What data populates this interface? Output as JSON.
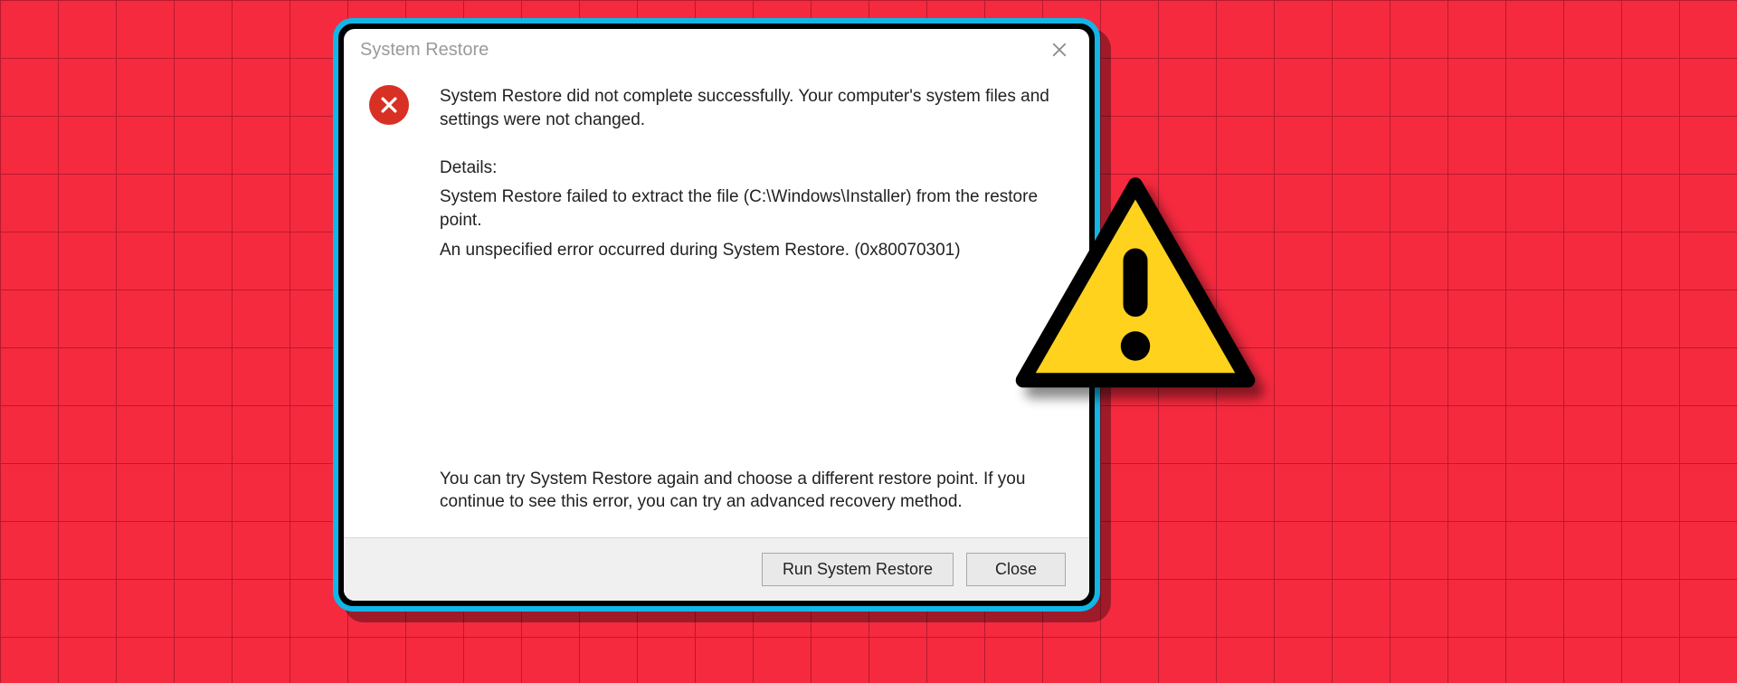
{
  "dialog": {
    "title": "System Restore",
    "summary": "System Restore did not complete successfully. Your computer's system files and settings were not changed.",
    "details_label": "Details:",
    "details_line1": "System Restore failed to extract the file (C:\\Windows\\Installer) from the restore point.",
    "details_line2": "An unspecified error occurred during System Restore. (0x80070301)",
    "advice": "You can try System Restore again and choose a different restore point. If you continue to see this error, you can try an advanced recovery method.",
    "buttons": {
      "run": "Run System Restore",
      "close": "Close"
    }
  }
}
